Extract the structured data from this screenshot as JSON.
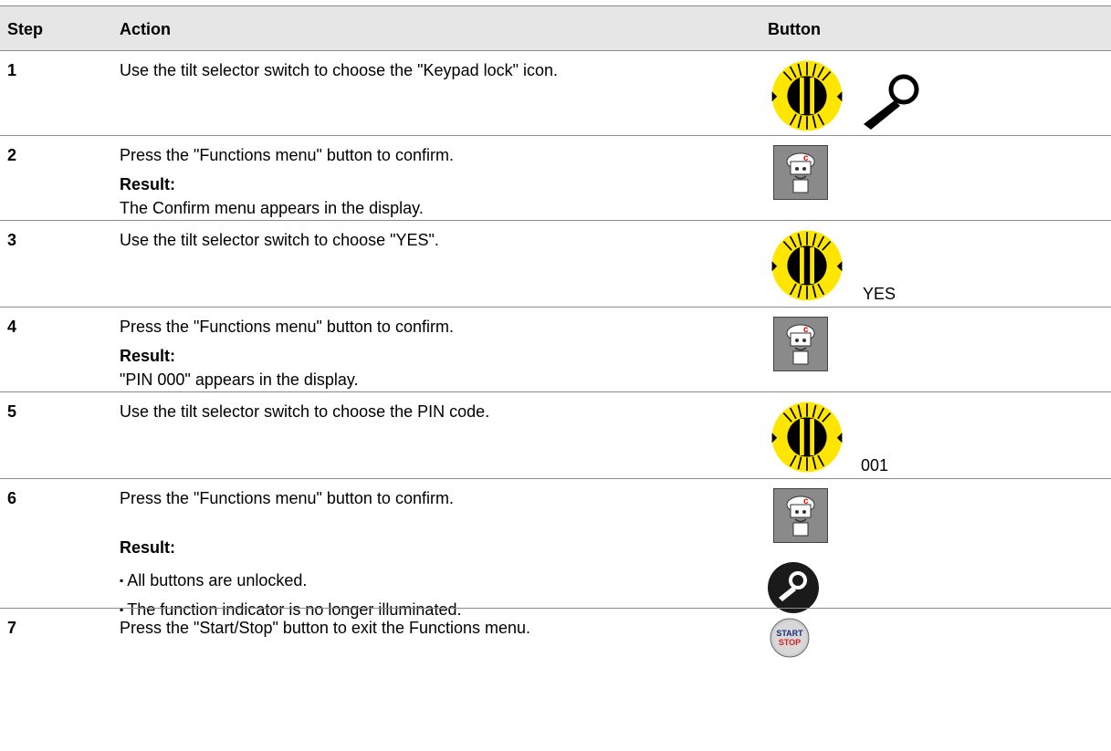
{
  "headers": {
    "step": "Step",
    "action": "Action",
    "button": "Button"
  },
  "rows": [
    {
      "step": "1",
      "action": "Use the tilt selector switch to choose the \"Keypad lock\" icon.",
      "icons": [
        "tilt-selector-icon",
        "key-icon"
      ]
    },
    {
      "step": "2",
      "action": "Press the \"Functions menu\" button to confirm.",
      "result_label": "Result:",
      "result_text": "The Confirm menu appears in the display.",
      "icons": [
        "functions-menu-icon"
      ]
    },
    {
      "step": "3",
      "action": "Use the tilt selector switch to choose \"YES\".",
      "readout": "YES",
      "icons": [
        "tilt-selector-icon"
      ]
    },
    {
      "step": "4",
      "action": "Press the \"Functions menu\" button to confirm.",
      "result_label": "Result:",
      "result_text": "\"PIN 000\" appears in the display.",
      "icons": [
        "functions-menu-icon"
      ]
    },
    {
      "step": "5",
      "action": "Use the tilt selector switch to choose the PIN code.",
      "readout": "001",
      "icons": [
        "tilt-selector-icon"
      ]
    },
    {
      "step": "6",
      "action": "Press the \"Functions menu\" button to confirm.",
      "result_label": "Result:",
      "bullets": [
        "All buttons are unlocked.",
        "The function indicator is no longer illuminated."
      ],
      "icons": [
        "functions-menu-icon",
        "key-circle-icon"
      ]
    },
    {
      "step": "7",
      "action": "Press the \"Start/Stop\" button to exit the Functions menu.",
      "icons": [
        "start-stop-icon"
      ],
      "start_stop": {
        "line1": "START",
        "line2": "STOP"
      }
    }
  ],
  "colors": {
    "header_bg": "#e6e6e6",
    "rule": "#8c8c8c",
    "dial_yellow": "#ffe600",
    "menu_grey": "#8a8a8a",
    "start_blue": "#1a2a7a",
    "stop_red": "#d42020"
  }
}
